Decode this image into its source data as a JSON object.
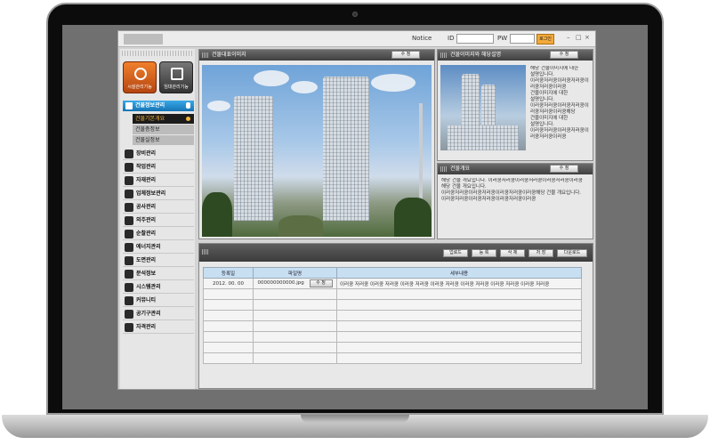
{
  "topbar": {
    "notice": "Notice",
    "id_label": "ID",
    "pw_label": "PW",
    "login_btn": "로그인",
    "minimize": "–",
    "maximize": "□",
    "close": "×"
  },
  "sidebar": {
    "big_buttons": [
      {
        "label": "시설관리기능"
      },
      {
        "label": "임대관리기능"
      }
    ],
    "section": {
      "label": "건물정보관리",
      "subitems": [
        "건물기본개요",
        "건물층정보",
        "건물실정보"
      ]
    },
    "items": [
      "장비관리",
      "작업관리",
      "자재관리",
      "업체정보관리",
      "공사관리",
      "외주관리",
      "순찰관리",
      "에너지관리",
      "도면관리",
      "분석정보",
      "시스템관리",
      "커뮤니티",
      "공기구관리",
      "자격관리"
    ]
  },
  "panels": {
    "main_image": {
      "title": "건물대표이미지",
      "edit": "수 정"
    },
    "side_image": {
      "title": "건물이미지와 해당설명",
      "edit": "수 정",
      "description": "해당 건물이미지에 대한\n설명입니다.\n이러쿵저러쿵이러쿵저러쿵이\n러쿵저러쿵이러쿵\n건물이미지에 대한\n설명입니다.\n이러쿵저러쿵이러쿵저러쿵이\n러쿵저러쿵이러쿵해당\n건물이미지에 대한\n설명입니다.\n이러쿵저러쿵이러쿵저러쿵이\n러쿵저러쿵이러쿵"
    },
    "overview": {
      "title": "건물개요",
      "edit": "수 정",
      "text": "해당 건물 개요입니다. 이러쿵저러쿵이러쿵저러쿵이러쿵저러쿵이러쿵\n해당 건물 개요입니다.\n이러쿵저러쿵이러쿵저러쿵이러쿵저러쿵이러쿵해당 건물 개요입니다.\n이러쿵저러쿵이러쿵저러쿵이러쿵저러쿵이러쿵"
    },
    "files": {
      "buttons": [
        "업로드",
        "등 록",
        "삭 제",
        "저 장",
        "다운로드"
      ],
      "columns": [
        "등록일",
        "파일명",
        "세부내용"
      ],
      "rows": [
        {
          "date": "2012. 00. 00",
          "file": "000000000000.jpg",
          "edit": "수 정",
          "content": "이러쿵 저러쿵 이러쿵 저러쿵 이러쿵 저러쿵 이러쿵 저러쿵 이러쿵 저러쿵 이러쿵 저러쿵 이러쿵 저러쿵"
        }
      ],
      "empty_rows": 7
    }
  }
}
